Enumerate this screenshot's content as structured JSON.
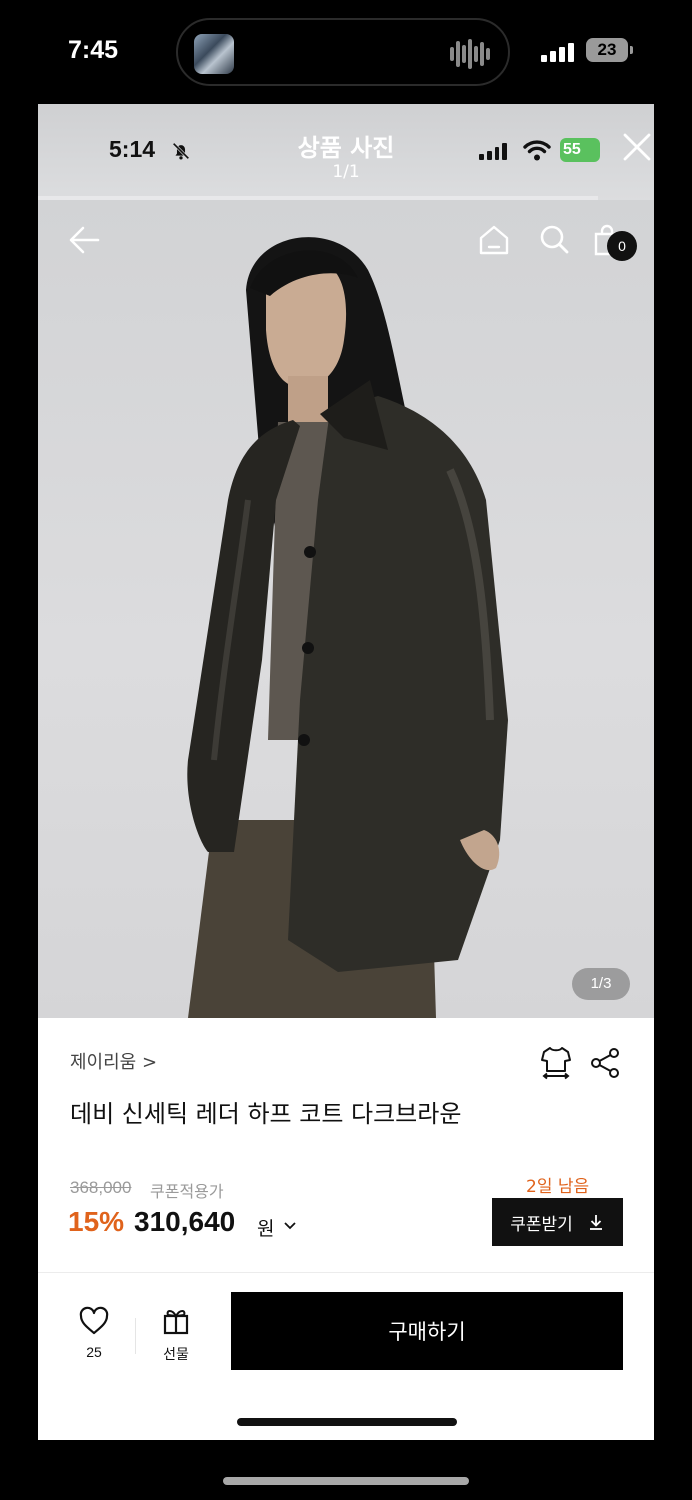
{
  "outer_status": {
    "time": "7:45",
    "battery": "23"
  },
  "viewer": {
    "time": "5:14",
    "title": "상품 사진",
    "count": "1/1",
    "battery": "55"
  },
  "photo": {
    "counter": "1/3",
    "cart_count": "0"
  },
  "product": {
    "brand": "제이리움 >",
    "name": "데비 신세틱 레더 하프 코트 다크브라운",
    "original_price": "368,000",
    "coupon_price_label": "쿠폰적용가",
    "discount": "15%",
    "price": "310,640",
    "currency": "원",
    "days_left": "2일 남음",
    "coupon_button": "쿠폰받기"
  },
  "bottom_bar": {
    "like_count": "25",
    "gift_label": "선물",
    "buy_label": "구매하기"
  }
}
